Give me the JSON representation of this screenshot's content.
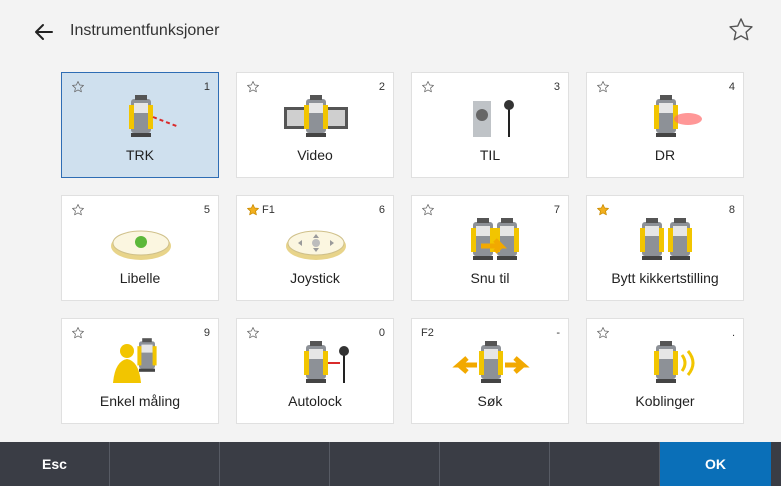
{
  "header": {
    "title": "Instrumentfunksjoner",
    "back_icon": "arrow-left-icon",
    "favorite_icon": "star-outline-icon"
  },
  "colors": {
    "accent": "#0a6fb8",
    "selected_bg": "#cfe0ee",
    "footer_bg": "#3a3d45",
    "star_filled": "#f2b01e"
  },
  "tiles": [
    {
      "label": "TRK",
      "number": "1",
      "fkey": "",
      "star": "outline",
      "selected": true,
      "icon": "instrument-laser-dashed-icon"
    },
    {
      "label": "Video",
      "number": "2",
      "fkey": "",
      "star": "outline",
      "selected": false,
      "icon": "instrument-video-icon"
    },
    {
      "label": "TIL",
      "number": "3",
      "fkey": "",
      "star": "outline",
      "selected": false,
      "icon": "target-pole-icon"
    },
    {
      "label": "DR",
      "number": "4",
      "fkey": "",
      "star": "outline",
      "selected": false,
      "icon": "instrument-laser-red-icon"
    },
    {
      "label": "Libelle",
      "number": "5",
      "fkey": "",
      "star": "outline",
      "selected": false,
      "icon": "level-bubble-icon"
    },
    {
      "label": "Joystick",
      "number": "6",
      "fkey": "F1",
      "star": "filled",
      "selected": false,
      "icon": "joystick-pad-icon"
    },
    {
      "label": "Snu til",
      "number": "7",
      "fkey": "",
      "star": "outline",
      "selected": false,
      "icon": "turn-to-icon"
    },
    {
      "label": "Bytt kikkertstilling",
      "number": "8",
      "fkey": "",
      "star": "filled",
      "selected": false,
      "icon": "change-face-icon"
    },
    {
      "label": "Enkel måling",
      "number": "9",
      "fkey": "",
      "star": "outline",
      "selected": false,
      "icon": "person-measure-icon"
    },
    {
      "label": "Autolock",
      "number": "0",
      "fkey": "",
      "star": "outline",
      "selected": false,
      "icon": "autolock-icon"
    },
    {
      "label": "Søk",
      "number": "-",
      "fkey": "F2",
      "star": "none",
      "selected": false,
      "icon": "search-arrows-icon"
    },
    {
      "label": "Koblinger",
      "number": ".",
      "fkey": "",
      "star": "outline",
      "selected": false,
      "icon": "connections-icon"
    }
  ],
  "footer": {
    "buttons": [
      "Esc",
      "",
      "",
      "",
      "",
      "",
      "OK"
    ]
  }
}
